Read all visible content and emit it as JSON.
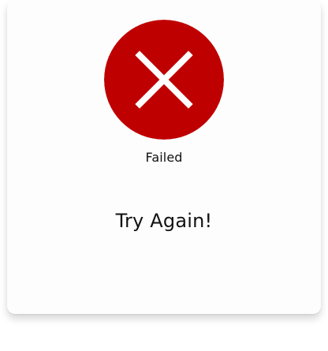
{
  "status": {
    "label": "Failed",
    "icon": "close-icon",
    "color": "#bf0000"
  },
  "message": {
    "text": "Try Again!"
  }
}
